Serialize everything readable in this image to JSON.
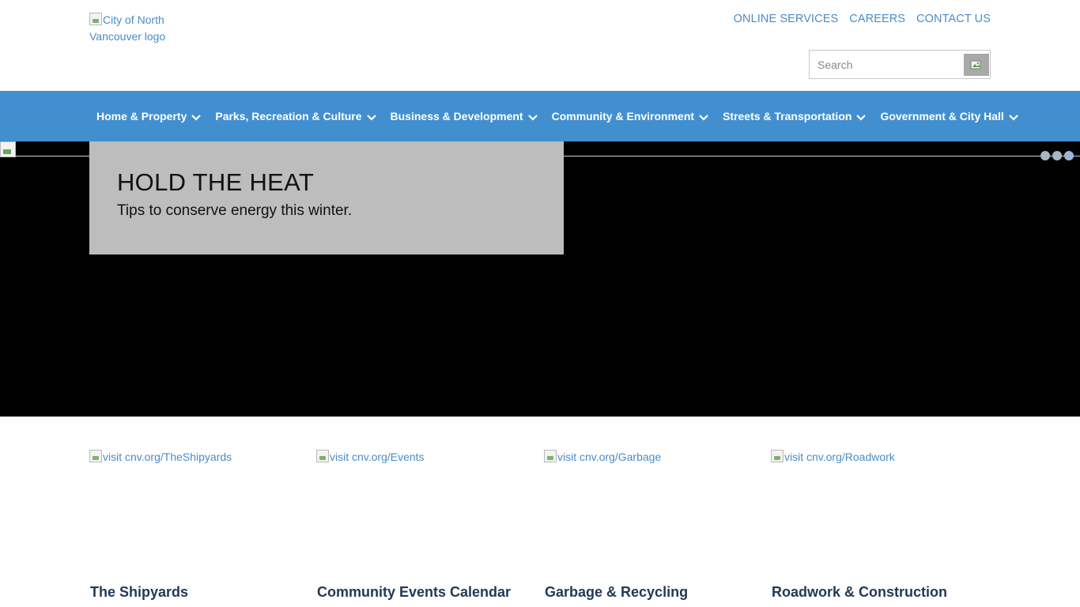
{
  "header": {
    "logo_alt": "City of North Vancouver logo",
    "top_links": [
      "ONLINE SERVICES",
      "CAREERS",
      "CONTACT US"
    ],
    "search_placeholder": "Search"
  },
  "nav": {
    "items": [
      "Home & Property",
      "Parks, Recreation & Culture",
      "Business & Development",
      "Community & Environment",
      "Streets & Transportation",
      "Government & City Hall"
    ]
  },
  "hero": {
    "title": "HOLD THE HEAT",
    "subtitle": "Tips to conserve energy this winter.",
    "slide_count": 3
  },
  "cards": [
    {
      "img_alt": "visit cnv.org/TheShipyards",
      "title": "The Shipyards"
    },
    {
      "img_alt": "visit cnv.org/Events",
      "title": "Community Events Calendar"
    },
    {
      "img_alt": "visit cnv.org/Garbage",
      "title": "Garbage & Recycling"
    },
    {
      "img_alt": "visit cnv.org/Roadwork",
      "title": "Roadwork & Construction"
    }
  ],
  "colors": {
    "nav_bg": "#428fd0",
    "link": "#4a8cc7",
    "hero_bg": "#000000",
    "hero_box": "#bdbdbd",
    "card_title": "#213a55"
  }
}
